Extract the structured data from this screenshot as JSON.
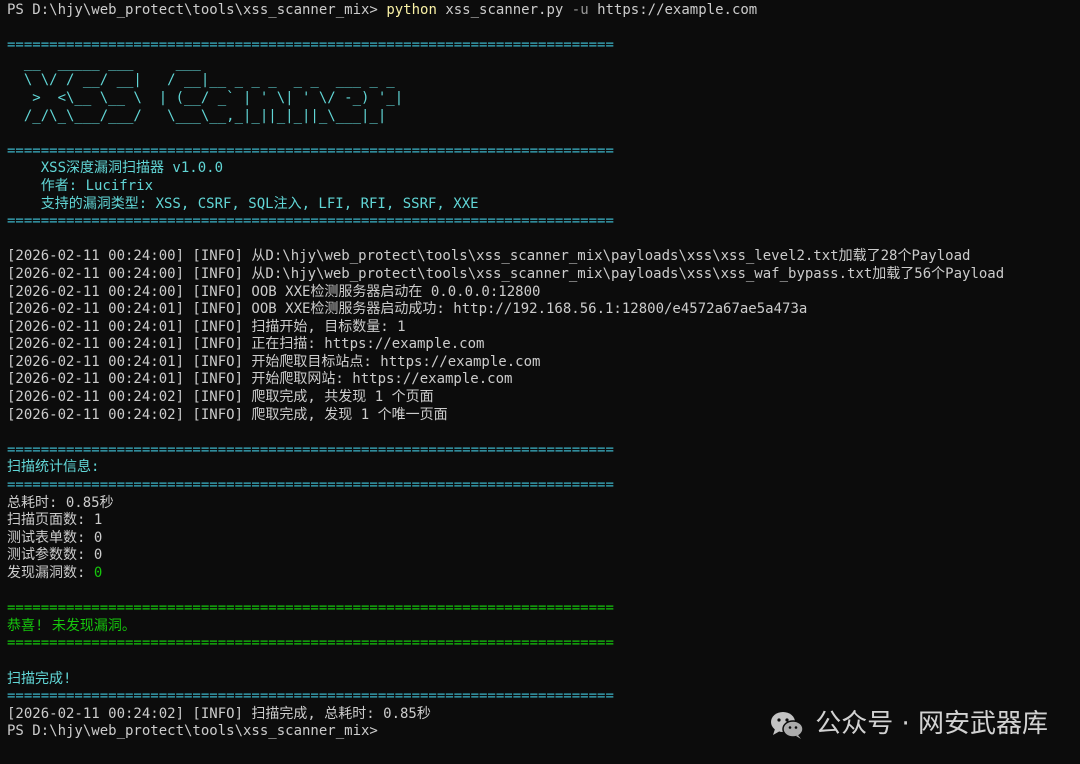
{
  "prompt": {
    "path": "PS D:\\hjy\\web_protect\\tools\\xss_scanner_mix>",
    "cmd": "python",
    "script": "xss_scanner.py",
    "flag": "-u",
    "url": "https://example.com"
  },
  "rule": "========================================================================",
  "banner": [
    "  __  _____ ___     ___",
    "  \\ \\/ / __/ __|   / __|__ _ _ _  _ _  ___ _ _",
    "   >  <\\__ \\__ \\  | (__/ _` | ' \\| ' \\/ -_) '_|",
    "  /_/\\_\\___/___/   \\___\\__,_|_||_|_||_\\___|_|"
  ],
  "info": {
    "title": "    XSS深度漏洞扫描器 v1.0.0",
    "author": "    作者: Lucifrix",
    "types": "    支持的漏洞类型: XSS, CSRF, SQL注入, LFI, RFI, SSRF, XXE"
  },
  "logs": [
    "[2026-02-11 00:24:00] [INFO] 从D:\\hjy\\web_protect\\tools\\xss_scanner_mix\\payloads\\xss\\xss_level2.txt加载了28个Payload",
    "[2026-02-11 00:24:00] [INFO] 从D:\\hjy\\web_protect\\tools\\xss_scanner_mix\\payloads\\xss\\xss_waf_bypass.txt加载了56个Payload",
    "[2026-02-11 00:24:00] [INFO] OOB XXE检测服务器启动在 0.0.0.0:12800",
    "[2026-02-11 00:24:01] [INFO] OOB XXE检测服务器启动成功: http://192.168.56.1:12800/e4572a67ae5a473a",
    "[2026-02-11 00:24:01] [INFO] 扫描开始, 目标数量: 1",
    "[2026-02-11 00:24:01] [INFO] 正在扫描: https://example.com",
    "[2026-02-11 00:24:01] [INFO] 开始爬取目标站点: https://example.com",
    "[2026-02-11 00:24:01] [INFO] 开始爬取网站: https://example.com",
    "[2026-02-11 00:24:02] [INFO] 爬取完成, 共发现 1 个页面",
    "[2026-02-11 00:24:02] [INFO] 爬取完成, 发现 1 个唯一页面"
  ],
  "stats": {
    "heading": "扫描统计信息:",
    "time": "总耗时: 0.85秒",
    "pages": "扫描页面数: 1",
    "forms": "测试表单数: 0",
    "params": "测试参数数: 0",
    "vulns_label": "发现漏洞数: ",
    "vulns_value": "0"
  },
  "result": "恭喜! 未发现漏洞。",
  "done": "扫描完成!",
  "final_log": "[2026-02-11 00:24:02] [INFO] 扫描完成, 总耗时: 0.85秒",
  "final_prompt": "PS D:\\hjy\\web_protect\\tools\\xss_scanner_mix>",
  "watermark": "公众号 · 网安武器库",
  "colors": {
    "background": "#0c0c0c",
    "cyan": "#3bb3c7",
    "green": "#16c60c",
    "yellow": "#f9f1a5"
  }
}
